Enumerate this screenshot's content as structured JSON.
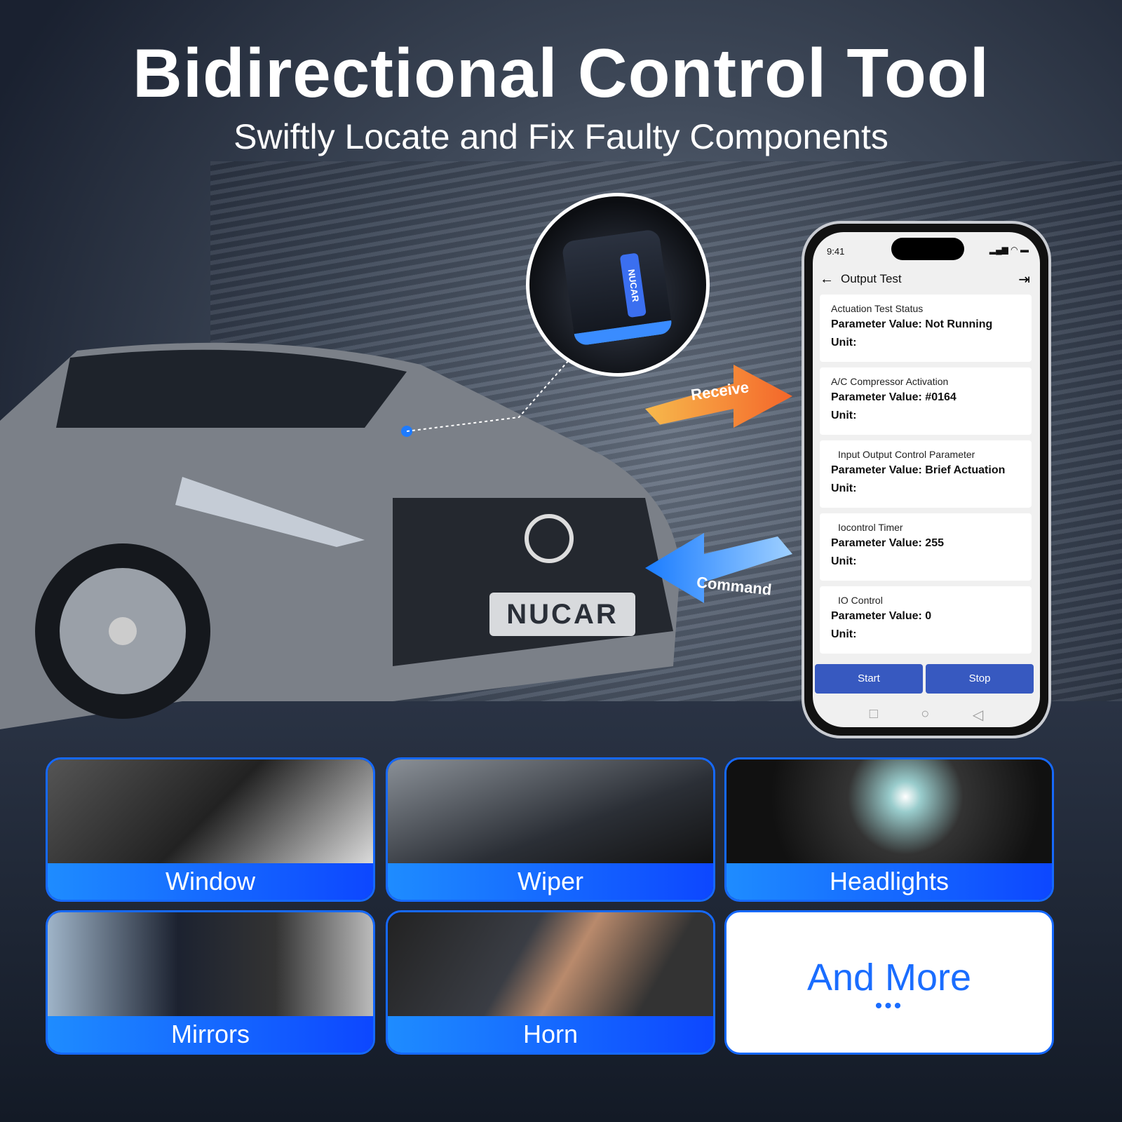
{
  "header": {
    "title": "Bidirectional Control Tool",
    "subtitle": "Swiftly Locate and Fix Faulty Components"
  },
  "brand": {
    "plate": "NUCAR",
    "device_label": "NUCAR"
  },
  "arrows": {
    "receive": "Receive",
    "command": "Command"
  },
  "phone": {
    "time": "9:41",
    "status_icons": "signal wifi battery",
    "title": "Output Test",
    "cards": [
      {
        "name": "Actuation Test Status",
        "value": "Parameter Value: Not Running",
        "unit": "Unit:"
      },
      {
        "name": "A/C Compressor Activation",
        "value": "Parameter Value: #0164",
        "unit": "Unit:"
      },
      {
        "name": "Input Output Control Parameter",
        "value": "Parameter Value: Brief Actuation",
        "unit": "Unit:"
      },
      {
        "name": "Iocontrol Timer",
        "value": "Parameter Value: 255",
        "unit": "Unit:"
      },
      {
        "name": "IO Control",
        "value": "Parameter Value: 0",
        "unit": "Unit:"
      }
    ],
    "start": "Start",
    "stop": "Stop",
    "colors": {
      "button": "#3759c0"
    }
  },
  "features": [
    "Window",
    "Wiper",
    "Headlights",
    "Mirrors",
    "Horn"
  ],
  "more": {
    "label": "And More",
    "dots": "•••"
  },
  "colors": {
    "accent": "#1669ff"
  }
}
